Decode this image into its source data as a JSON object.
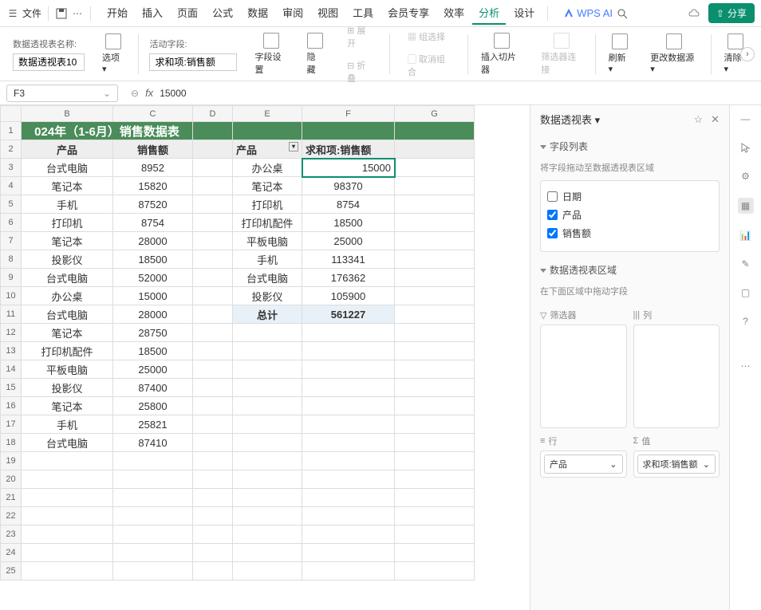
{
  "topbar": {
    "file": "文件",
    "menus": [
      "开始",
      "插入",
      "页面",
      "公式",
      "数据",
      "审阅",
      "视图",
      "工具",
      "会员专享",
      "效率",
      "分析",
      "设计"
    ],
    "active": 10,
    "ai": "WPS AI",
    "share": "分享"
  },
  "ribbon": {
    "name_lbl": "数据透视表名称:",
    "name_val": "数据透视表10",
    "opt": "选项",
    "active_lbl": "活动字段:",
    "active_val": "求和项:销售额",
    "fset": "字段设置",
    "hide": "隐藏",
    "expand": "展开",
    "collapse": "折叠",
    "grpsel": "组选择",
    "ungrp": "取消组合",
    "slicer": "插入切片器",
    "filter": "筛选器连接",
    "refresh": "刷新",
    "chgsrc": "更改数据源",
    "clear": "清除"
  },
  "fbar": {
    "cell": "F3",
    "val": "15000"
  },
  "sheet": {
    "cols": [
      "B",
      "C",
      "D",
      "E",
      "F",
      "G"
    ],
    "title": "024年（1-6月）销售数据表",
    "hdr": [
      "产品",
      "销售额"
    ],
    "rows": [
      [
        "台式电脑",
        "8952"
      ],
      [
        "笔记本",
        "15820"
      ],
      [
        "手机",
        "87520"
      ],
      [
        "打印机",
        "8754"
      ],
      [
        "笔记本",
        "28000"
      ],
      [
        "投影仪",
        "18500"
      ],
      [
        "台式电脑",
        "52000"
      ],
      [
        "办公桌",
        "15000"
      ],
      [
        "台式电脑",
        "28000"
      ],
      [
        "笔记本",
        "28750"
      ],
      [
        "打印机配件",
        "18500"
      ],
      [
        "平板电脑",
        "25000"
      ],
      [
        "投影仪",
        "87400"
      ],
      [
        "笔记本",
        "25800"
      ],
      [
        "手机",
        "25821"
      ],
      [
        "台式电脑",
        "87410"
      ]
    ],
    "pv_hdr": [
      "产品",
      "求和项:销售额"
    ],
    "pv_rows": [
      [
        "办公桌",
        "15000"
      ],
      [
        "笔记本",
        "98370"
      ],
      [
        "打印机",
        "8754"
      ],
      [
        "打印机配件",
        "18500"
      ],
      [
        "平板电脑",
        "25000"
      ],
      [
        "手机",
        "113341"
      ],
      [
        "台式电脑",
        "176362"
      ],
      [
        "投影仪",
        "105900"
      ]
    ],
    "pv_total": [
      "总计",
      "561227"
    ]
  },
  "panel": {
    "title": "数据透视表",
    "sect1": "字段列表",
    "hint1": "将字段拖动至数据透视表区域",
    "fields": [
      {
        "n": "日期",
        "c": false
      },
      {
        "n": "产品",
        "c": true
      },
      {
        "n": "销售额",
        "c": true
      }
    ],
    "sect2": "数据透视表区域",
    "hint2": "在下面区域中拖动字段",
    "a_filter": "筛选器",
    "a_col": "列",
    "a_row": "行",
    "a_val": "值",
    "row_item": "产品",
    "val_item": "求和项:销售额"
  }
}
